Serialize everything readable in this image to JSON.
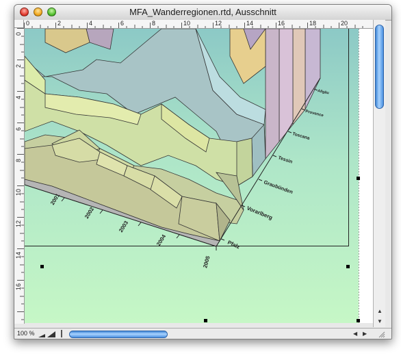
{
  "window": {
    "title": "MFA_Wanderregionen.rtd, Ausschnitt",
    "zoom_label": "100 %"
  },
  "rulers": {
    "horizontal": [
      "0",
      "2",
      "4",
      "6",
      "8",
      "10",
      "12",
      "14",
      "16",
      "18",
      "20"
    ],
    "vertical": [
      "0",
      "2",
      "4",
      "6",
      "8",
      "10",
      "12",
      "14",
      "16"
    ]
  },
  "chart_data": {
    "type": "3d-area",
    "categories": [
      "2001",
      "2002",
      "2003",
      "2004",
      "2005"
    ],
    "series": [
      {
        "name": "Pfalz"
      },
      {
        "name": "Vorarlberg"
      },
      {
        "name": "Graubünden"
      },
      {
        "name": "Tessin"
      },
      {
        "name": "Toscana"
      },
      {
        "name": "Provence"
      },
      {
        "name": "Allgäu"
      }
    ],
    "legend": "right-diagonal"
  },
  "colors": {
    "background_top": "#8cc9c6",
    "background_bottom": "#c6f7c6",
    "scroll_accent": "#4a90e0"
  }
}
